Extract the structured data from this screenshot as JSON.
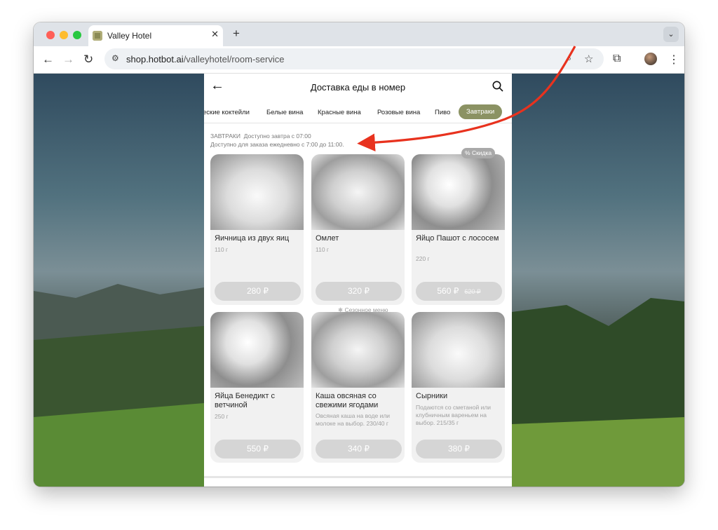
{
  "browser": {
    "tab_title": "Valley Hotel",
    "url_host": "shop.hotbot.ai",
    "url_path": "/valleyhotel/room-service",
    "new_tab": "+",
    "close_tab": "✕",
    "tab_menu": "⌄"
  },
  "app": {
    "title": "Доставка еды в номер",
    "categories": [
      "еские коктейли",
      "Белые вина",
      "Красные вина",
      "Розовые вина",
      "Пиво",
      "Завтраки"
    ],
    "active_category": "Завтраки",
    "section": {
      "name": "ЗАВТРАКИ",
      "availability": "Доступно завтра с 07:00",
      "note": "Доступно для заказа ежедневно с 7:00 до 11:00."
    },
    "badges": {
      "discount": "Скидка",
      "seasonal": "Сезонное меню"
    },
    "items": [
      {
        "name": "Яичница из двух яиц",
        "desc": "110 г",
        "price": "280 ₽"
      },
      {
        "name": "Омлет",
        "desc": "110 г",
        "price": "320 ₽"
      },
      {
        "name": "Яйцо Пашот с лососем",
        "desc": "220 г",
        "price": "560 ₽",
        "old_price": "620 ₽"
      },
      {
        "name": "Яйца Бенедикт с ветчиной",
        "desc": "250 г",
        "price": "550 ₽"
      },
      {
        "name": "Каша овсяная со свежими ягодами",
        "desc": "Овсяная каша на воде или молоке на выбор. 230/40 г",
        "price": "340 ₽"
      },
      {
        "name": "Сырники",
        "desc": "Подаются со сметаной или клубничным вареньем на выбор. 215/35 г",
        "price": "380 ₽"
      }
    ]
  },
  "colors": {
    "accent": "#8b9263",
    "annotation": "#e8321e"
  },
  "icons": [
    "back-arrow-icon",
    "search-icon",
    "star-icon",
    "extensions-icon",
    "menu-dots-icon",
    "percent-icon",
    "snowflake-icon"
  ]
}
